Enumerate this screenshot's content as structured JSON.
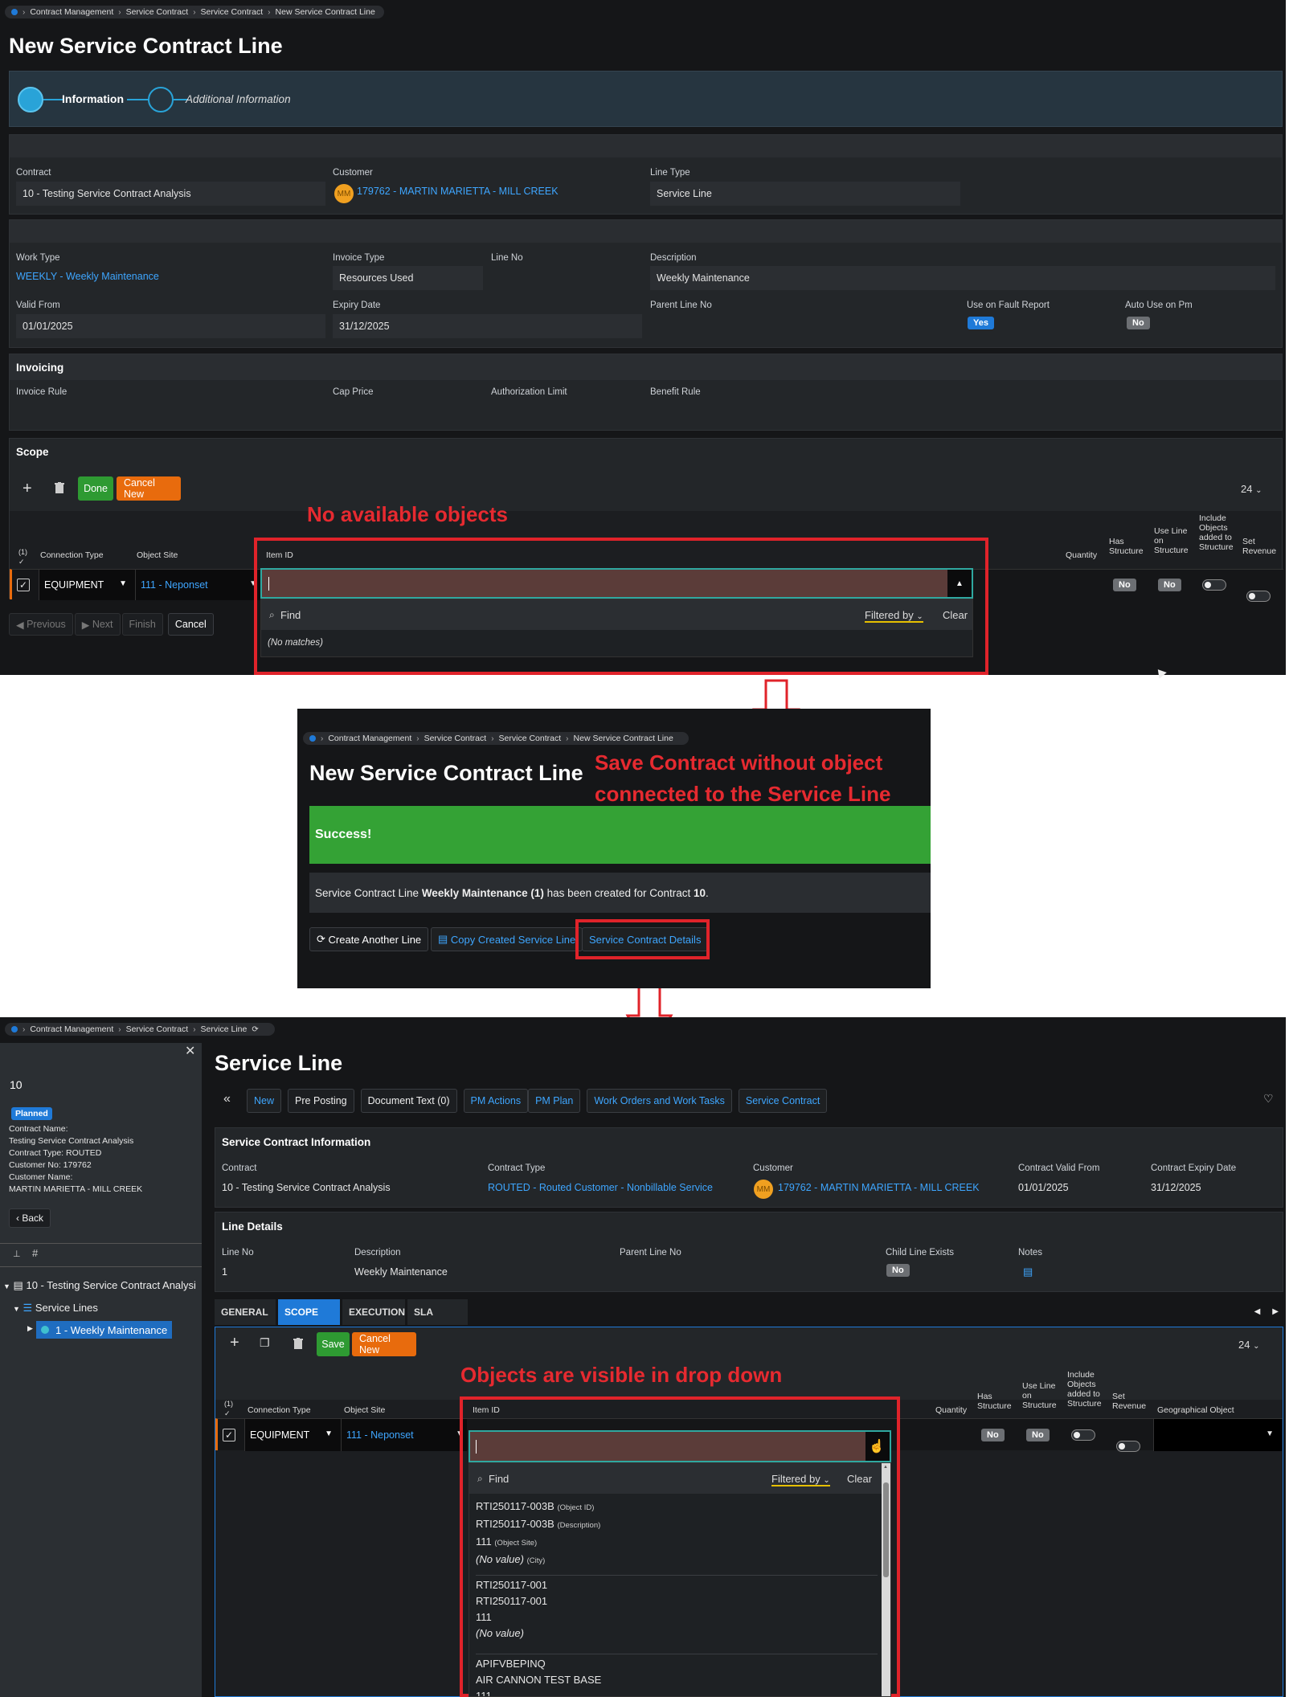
{
  "s1": {
    "crumbs": [
      "Contract Management",
      "Service Contract",
      "Service Contract",
      "New Service Contract Line"
    ],
    "title": "New Service Contract Line",
    "step1": "Information",
    "step2": "Additional Information",
    "contract_label": "Contract",
    "contract_value": "10 - Testing Service Contract Analysis",
    "customer_label": "Customer",
    "customer_avatar": "MM",
    "customer_value": "179762 - MARTIN MARIETTA - MILL CREEK",
    "linetype_label": "Line Type",
    "linetype_value": "Service Line",
    "worktype_label": "Work Type",
    "worktype_value": "WEEKLY - Weekly Maintenance",
    "invtype_label": "Invoice Type",
    "invtype_value": "Resources Used",
    "lineno_label": "Line No",
    "desc_label": "Description",
    "desc_value": "Weekly Maintenance",
    "validfrom_label": "Valid From",
    "validfrom_value": "01/01/2025",
    "expiry_label": "Expiry Date",
    "expiry_value": "31/12/2025",
    "parent_label": "Parent Line No",
    "fault_label": "Use on Fault Report",
    "fault_value": "Yes",
    "autopm_label": "Auto Use on Pm",
    "autopm_value": "No",
    "invoicing_title": "Invoicing",
    "invrule_label": "Invoice Rule",
    "cap_label": "Cap Price",
    "auth_label": "Authorization Limit",
    "benefit_label": "Benefit Rule",
    "scope_title": "Scope",
    "done": "Done",
    "cancel_new": "Cancel New",
    "page_size": "24",
    "annot": "No available objects",
    "cols": {
      "count": "(1)",
      "conn": "Connection Type",
      "site": "Object Site",
      "item": "Item ID",
      "qty": "Quantity",
      "has": "Has Structure",
      "use": "Use Line on Structure",
      "incl": "Include Objects added to Structure",
      "setrev": "Set Revenue"
    },
    "row": {
      "conn": "EQUIPMENT",
      "site": "111 - Neponset",
      "has": "No",
      "use": "No"
    },
    "find": "Find",
    "filtered": "Filtered by",
    "clear": "Clear",
    "nomatch": "(No matches)",
    "nav": {
      "prev": "Previous",
      "next": "Next",
      "finish": "Finish",
      "cancel": "Cancel"
    }
  },
  "s2": {
    "crumbs": [
      "Contract Management",
      "Service Contract",
      "Service Contract",
      "New Service Contract Line"
    ],
    "title": "New Service Contract Line",
    "annot1": "Save Contract without object",
    "annot2": "connected to the Service Line",
    "success": "Success!",
    "msg_a": "Service Contract Line ",
    "msg_b": "Weekly Maintenance (1)",
    "msg_c": " has been created for Contract ",
    "msg_d": "10",
    "msg_e": ".",
    "btn_create": "Create Another Line",
    "btn_copy": "Copy Created Service Line",
    "btn_details": "Service Contract Details"
  },
  "s3": {
    "crumbs": [
      "Contract Management",
      "Service Contract",
      "Service Line"
    ],
    "side": {
      "id": "10",
      "status": "Planned",
      "l1": "Contract Name:",
      "l2": "Testing Service Contract Analysis",
      "l3": "Contract Type:  ROUTED",
      "l4": "Customer No:  179762",
      "l5": "Customer Name:",
      "l6": "MARTIN MARIETTA - MILL CREEK",
      "back": "Back",
      "tree_root": "10 - Testing Service Contract Analysi",
      "tree_lines": "Service Lines",
      "tree_item": "1 - Weekly Maintenance"
    },
    "title": "Service Line",
    "toolbar": [
      "New",
      "Pre Posting",
      "Document Text (0)",
      "PM Actions",
      "PM Plan",
      "Work Orders and Work Tasks",
      "Service Contract"
    ],
    "sci_title": "Service Contract Information",
    "contract_label": "Contract",
    "contract_value": "10 - Testing Service Contract Analysis",
    "ctype_label": "Contract Type",
    "ctype_value": "ROUTED - Routed Customer - Nonbillable Service",
    "cust_label": "Customer",
    "cust_avatar": "MM",
    "cust_value": "179762 - MARTIN MARIETTA - MILL CREEK",
    "vfrom_label": "Contract Valid From",
    "vfrom_value": "01/01/2025",
    "vexp_label": "Contract Expiry Date",
    "vexp_value": "31/12/2025",
    "ld_title": "Line Details",
    "lineno_label": "Line No",
    "lineno_value": "1",
    "desc_label": "Description",
    "desc_value": "Weekly Maintenance",
    "parent_label": "Parent Line No",
    "child_label": "Child Line Exists",
    "child_value": "No",
    "notes_label": "Notes",
    "tabs": [
      "GENERAL",
      "SCOPE",
      "EXECUTION",
      "SLA"
    ],
    "save": "Save",
    "cancel_new": "Cancel New",
    "page_size": "24",
    "annot": "Objects are visible in drop down",
    "cols": {
      "count": "(1)",
      "conn": "Connection Type",
      "site": "Object Site",
      "item": "Item ID",
      "qty": "Quantity",
      "has": "Has Structure",
      "use": "Use Line on Structure",
      "incl": "Include Objects added to Structure",
      "setrev": "Set Revenue",
      "geo": "Geographical Object"
    },
    "row": {
      "conn": "EQUIPMENT",
      "site": "111 - Neponset",
      "has": "No",
      "use": "No"
    },
    "find": "Find",
    "filtered": "Filtered by",
    "clear": "Clear",
    "options": [
      {
        "a": "RTI250117-003B",
        "at": "(Object ID)",
        "b": "RTI250117-003B",
        "bt": "(Description)",
        "c": "111",
        "ct": "(Object Site)",
        "d": "(No value)",
        "dt": "(City)"
      },
      {
        "a": "RTI250117-001",
        "b": "RTI250117-001",
        "c": "111",
        "d": "(No value)"
      },
      {
        "a": "APIFVBEPINQ",
        "b": "AIR CANNON TEST BASE",
        "c": "111"
      }
    ]
  },
  "colors": {
    "accent": "#1f7ad8",
    "green": "#2e9a32",
    "orange": "#e86b0d",
    "annot_red": "#e0232a"
  }
}
